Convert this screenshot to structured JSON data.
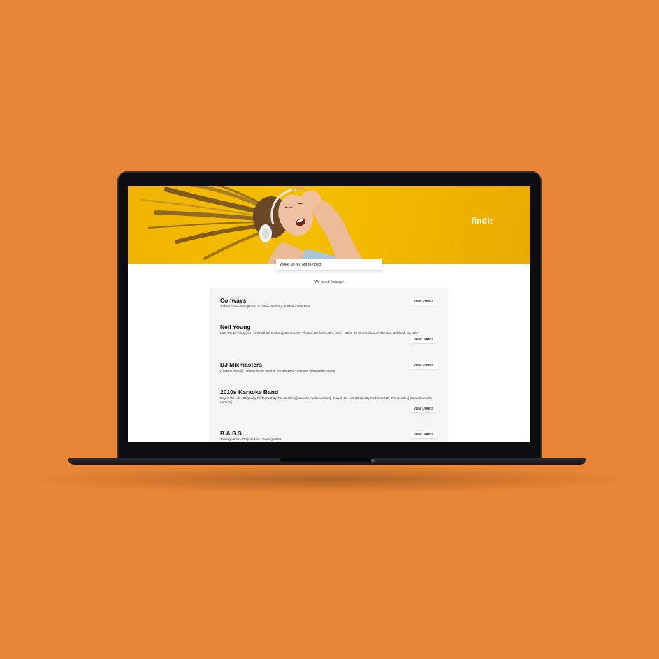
{
  "brand": {
    "logo_text": "findit"
  },
  "search": {
    "value": "Woke up fell out the bed"
  },
  "results": {
    "count_text": "We found 9 songs!",
    "button_label": "VIEW LYRICS",
    "items": [
      {
        "artist": "Conways",
        "songs": "A Walk in the Park (Radio & Video-Version) - A Walk in the Park"
      },
      {
        "artist": "Neil Young",
        "songs": "Last Trip to Tulsa (live: 1999-03-19: Berkeley Community Theater, Berkeley, CA, USA) - 1999-03-20: Paramount Theatre, Oakland, CA, USA"
      },
      {
        "artist": "DJ Mixmasters",
        "songs": "A Day in the Life (Tribute in the Style of the Beatles) - Ultimate the Beatles Tones"
      },
      {
        "artist": "2010s Karaoke Band",
        "songs": "Day in the Life (Originally Performed By The Beatles) [Karaoke Audio Version] - Day in the Life (Originally Performed By The Beatles) [Karaoke Audio Version]"
      },
      {
        "artist": "B.A.S.S.",
        "songs": "Teenage Kiss - Original Mix - Teenage Kiss"
      }
    ]
  },
  "colors": {
    "background": "#E88536",
    "hero": "#F4BE00",
    "panel": "#F5F5F5"
  }
}
